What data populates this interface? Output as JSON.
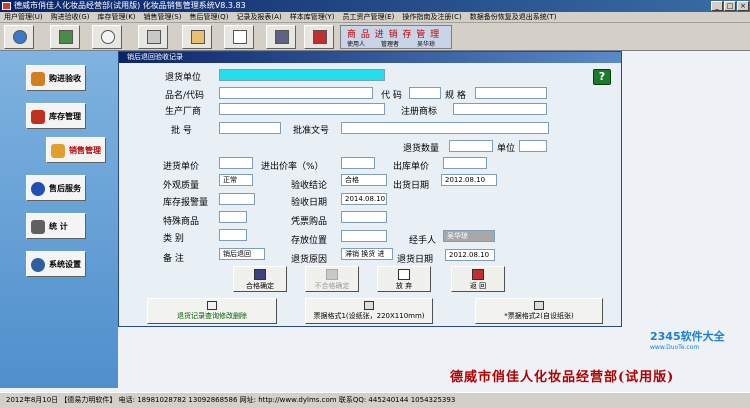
{
  "window": {
    "title": "德威市俏佳人化妆品经营部(试用版) 化妆品销售管理系统V8.3.83"
  },
  "menu": [
    "用户管理(U)",
    "购进验收(G)",
    "库存管理(K)",
    "销售管理(S)",
    "售后管理(Q)",
    "记录及报表(A)",
    "样本库管理(Y)",
    "员工资产管理(E)",
    "操作指南及注册(C)",
    "数据备份恢复及退出系统(T)"
  ],
  "toolbar": {
    "banner_title": "商 品 进 销 存 管 理",
    "user_label": "使用人",
    "role": "管理者",
    "operator": "吴华琼",
    "icons": [
      "refresh-icon",
      "document-icon",
      "search-icon",
      "calculator-icon",
      "edit-icon",
      "chart-icon",
      "save-icon",
      "exit-icon"
    ]
  },
  "sidebar": {
    "items": [
      {
        "label": "购进验收",
        "icon": "cart-icon",
        "color": "#d08020"
      },
      {
        "label": "库存管理",
        "icon": "box-icon",
        "color": "#c03020"
      },
      {
        "label": "销售管理",
        "icon": "sales-icon",
        "color": "#e0a030"
      },
      {
        "label": "售后服务",
        "icon": "service-icon",
        "color": "#2050b0"
      },
      {
        "label": "统  计",
        "icon": "stats-icon",
        "color": "#606060"
      },
      {
        "label": "系统设置",
        "icon": "settings-icon",
        "color": "#3060a0"
      }
    ]
  },
  "dialog": {
    "title": "销后退回验收记录",
    "labels": {
      "return_unit": "退货单位",
      "product_code": "品名/代码",
      "code": "代 码",
      "spec": "规 格",
      "manufacturer": "生产厂商",
      "trademark": "注册商标",
      "batch": "批    号",
      "approval_no": "批准文号",
      "return_qty": "退货数量",
      "unit": "单位",
      "purchase_price": "进货单价",
      "in_out_rate": "进出价率（%）",
      "out_price": "出库单价",
      "appearance": "外观质量",
      "conclusion": "验收结论",
      "ship_date": "出货日期",
      "stock_alert": "库存报警量",
      "acceptance_date": "验收日期",
      "special_goods": "特殊商品",
      "voucher_goods": "凭票购品",
      "category": "类    别",
      "storage": "存放位置",
      "handler": "经手人",
      "remark": "备    注",
      "return_reason": "退货原因",
      "return_date": "退货日期"
    },
    "values": {
      "return_unit": "",
      "appearance": "正常",
      "conclusion": "合格",
      "ship_date": "2012.08.10",
      "acceptance_date": "2014.08.10",
      "handler": "吴华琼",
      "remark": "销后退回",
      "return_reason": "滞销 换货  进",
      "return_date": "2012.08.10"
    },
    "buttons": {
      "qualified": "合格确定",
      "unqualified": "不合格确定",
      "discard": "放  弃",
      "back": "返  回"
    },
    "print": {
      "query": "退货记录查询修改删除",
      "format1": "票据格式1(设纸张，220X110mm)",
      "format2": "*票据格式2(自设纸张)"
    }
  },
  "branding": {
    "logo": "2345软件大全",
    "logo_url": "www.DuoTe.com",
    "company": "德威市俏佳人化妆品经营部(试用版)"
  },
  "statusbar": "2012年8月10日 【德易力明软件】 电话: 18981028782  13092868586 网址: http://www.dylms.com  联系QQ: 445240144  1054325393"
}
